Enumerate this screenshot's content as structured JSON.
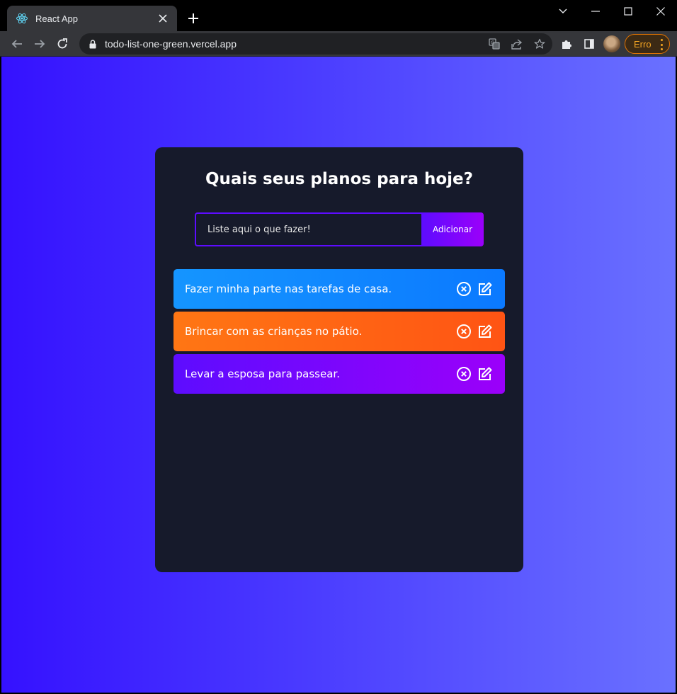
{
  "browser": {
    "tab_title": "React App",
    "url": "todo-list-one-green.vercel.app",
    "profile_button_label": "Erro",
    "icons": {
      "favicon": "react-atom-icon",
      "back": "back-arrow-icon",
      "forward": "forward-arrow-icon",
      "reload": "reload-icon",
      "lock": "lock-icon",
      "translate": "translate-icon",
      "share": "share-icon",
      "bookmark": "star-icon",
      "extensions": "puzzle-icon",
      "sidepanel": "side-panel-icon"
    }
  },
  "app": {
    "heading": "Quais seus planos para hoje?",
    "input_placeholder": "Liste aqui o que fazer!",
    "add_button_label": "Adicionar",
    "colors": {
      "card_bg": "#161a2b",
      "accent": "#5d0cff",
      "accent_end": "#9b00fa",
      "todo_blue": "#1595ff",
      "todo_orange": "#ff7614",
      "todo_purple": "#5d0cff"
    },
    "todos": [
      {
        "text": "Fazer minha parte nas tarefas de casa.",
        "color": "blue"
      },
      {
        "text": "Brincar com as crianças no pátio.",
        "color": "orange"
      },
      {
        "text": "Levar a esposa para passear.",
        "color": "purple"
      }
    ]
  }
}
